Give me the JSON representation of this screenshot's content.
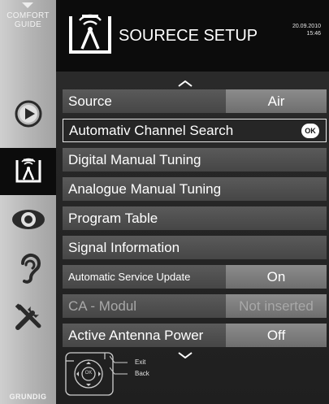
{
  "sidebar": {
    "title": "COMFORT\nGUIDE",
    "icons": [
      "source-icon",
      "antenna-icon",
      "picture-icon",
      "sound-icon",
      "tools-icon"
    ],
    "brand": "GRUNDIG"
  },
  "header": {
    "title": "SOURECE SETUP",
    "date": "20.09.2010",
    "time": "15:46"
  },
  "menu": {
    "items": [
      {
        "label": "Source",
        "value": "Air"
      },
      {
        "label": "Automativ Channel Search",
        "badge": "OK"
      },
      {
        "label": "Digital Manual Tuning"
      },
      {
        "label": "Analogue Manual Tuning"
      },
      {
        "label": "Program Table"
      },
      {
        "label": "Signal Information"
      },
      {
        "label": "Automatic Service Update",
        "value": "On"
      },
      {
        "label": "CA - Modul",
        "value": "Not inserted"
      },
      {
        "label": "Active Antenna Power",
        "value": "Off"
      }
    ]
  },
  "footer": {
    "remote_center": "OK",
    "exit_label": "Exit",
    "back_label": "Back"
  },
  "colors": {
    "background": "#0c0c0c",
    "row": "#4e4e4e",
    "value_cell": "#7c7c7c",
    "sidebar": "#b8b8b8"
  }
}
